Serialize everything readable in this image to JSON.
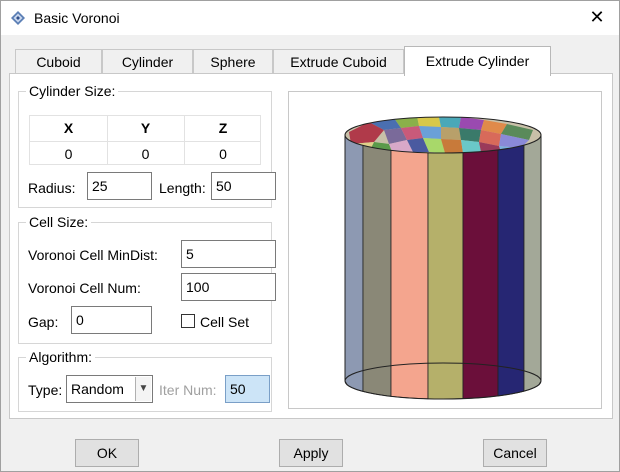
{
  "window": {
    "title": "Basic Voronoi",
    "close_symbol": "✕"
  },
  "tabs": [
    {
      "label": "Cuboid"
    },
    {
      "label": "Cylinder"
    },
    {
      "label": "Sphere"
    },
    {
      "label": "Extrude Cuboid"
    },
    {
      "label": "Extrude Cylinder",
      "active": true
    }
  ],
  "cylinder_size": {
    "title": "Cylinder Size:",
    "columns": [
      "X",
      "Y",
      "Z"
    ],
    "values": [
      "0",
      "0",
      "0"
    ],
    "radius_label": "Radius:",
    "radius_value": "25",
    "length_label": "Length:",
    "length_value": "50"
  },
  "cell_size": {
    "title": "Cell Size:",
    "mindist_label": "Voronoi Cell MinDist:",
    "mindist_value": "5",
    "num_label": "Voronoi Cell Num:",
    "num_value": "100",
    "gap_label": "Gap:",
    "gap_value": "0",
    "cellset_label": "Cell Set",
    "cellset_checked": false
  },
  "algorithm": {
    "title": "Algorithm:",
    "type_label": "Type:",
    "type_value": "Random",
    "iter_label": "Iter Num:",
    "iter_value": "50"
  },
  "preview": {
    "stripe_colors": [
      "#8d99b2",
      "#8a8877",
      "#f4a58e",
      "#b5b06a",
      "#6b0f3a",
      "#262673",
      "#a3a898",
      "#b8920b"
    ]
  },
  "buttons": {
    "ok": "OK",
    "apply": "Apply",
    "cancel": "Cancel"
  }
}
